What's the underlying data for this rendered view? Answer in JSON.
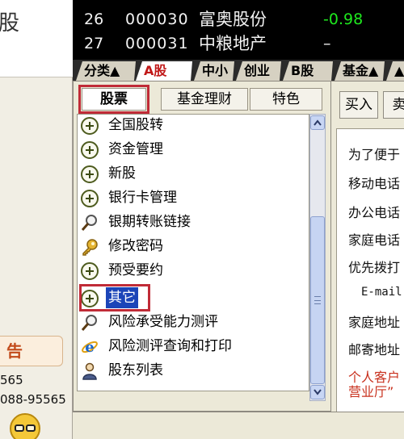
{
  "left": {
    "header_text": "股",
    "notice_label": "告",
    "phone_1": "565",
    "phone_2": "088-95565"
  },
  "stock_rows": [
    {
      "index": "26",
      "code": "000030",
      "name": "富奥股份",
      "change": "-0.98"
    },
    {
      "index": "27",
      "code": "000031",
      "name": "中粮地产",
      "change": "–"
    }
  ],
  "market_tabs": [
    "分类▲",
    "A股",
    "中小",
    "创业",
    "B股",
    "基金▲",
    "▲"
  ],
  "function_tabs": {
    "stock": "股票",
    "fund": "基金理财",
    "special": "特色"
  },
  "tree_items": [
    {
      "label": "全国股转",
      "icon": "plus-icon"
    },
    {
      "label": "资金管理",
      "icon": "plus-icon"
    },
    {
      "label": "新股",
      "icon": "plus-icon"
    },
    {
      "label": "银行卡管理",
      "icon": "plus-icon"
    },
    {
      "label": "银期转账链接",
      "icon": "magnifier-icon"
    },
    {
      "label": "修改密码",
      "icon": "key-icon"
    },
    {
      "label": "预受要约",
      "icon": "plus-icon"
    },
    {
      "label": "其它",
      "icon": "plus-icon"
    },
    {
      "label": "风险承受能力测评",
      "icon": "magnifier-icon"
    },
    {
      "label": "风险测评查询和打印",
      "icon": "ie-icon"
    },
    {
      "label": "股东列表",
      "icon": "person-icon"
    }
  ],
  "form": {
    "buy_label": "买入",
    "sell_label": "卖",
    "lines": [
      "为了便于",
      "移动电话",
      "办公电话",
      "家庭电话",
      "优先拨打",
      "E-mail",
      "家庭地址",
      "邮寄地址",
      "个人客户",
      "营业厅”"
    ]
  },
  "colors": {
    "up_down_green": "#1ee81e",
    "active_tab_red": "#c01818",
    "selection_blue": "#1b45b8",
    "highlight_box_red": "#c02b37"
  }
}
